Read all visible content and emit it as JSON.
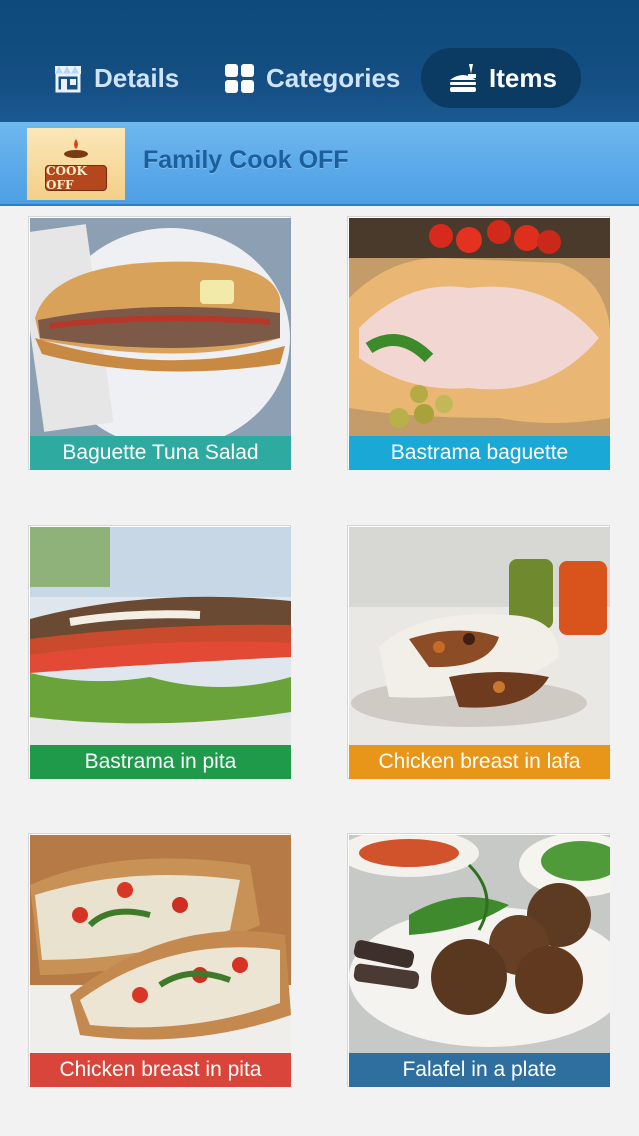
{
  "nav": {
    "tabs": [
      {
        "label": "Details",
        "icon": "store-icon",
        "active": false
      },
      {
        "label": "Categories",
        "icon": "grid-icon",
        "active": false
      },
      {
        "label": "Items",
        "icon": "food-icon",
        "active": true
      }
    ]
  },
  "store": {
    "name": "Family Cook OFF",
    "logo_text": "COOK OFF"
  },
  "items": [
    {
      "name": "Baguette Tuna Salad",
      "color": "#2eaaa0"
    },
    {
      "name": "Bastrama baguette",
      "color": "#1aa9d6"
    },
    {
      "name": "Bastrama in pita",
      "color": "#1f9a4a"
    },
    {
      "name": "Chicken breast in lafa",
      "color": "#e8961a"
    },
    {
      "name": "Chicken breast in pita",
      "color": "#d9453a"
    },
    {
      "name": "Falafel in a plate",
      "color": "#2f6f9f"
    }
  ],
  "colors": {
    "header": "#154f83",
    "store_bar": "#5aa8ea",
    "store_name": "#1b5f9e"
  }
}
